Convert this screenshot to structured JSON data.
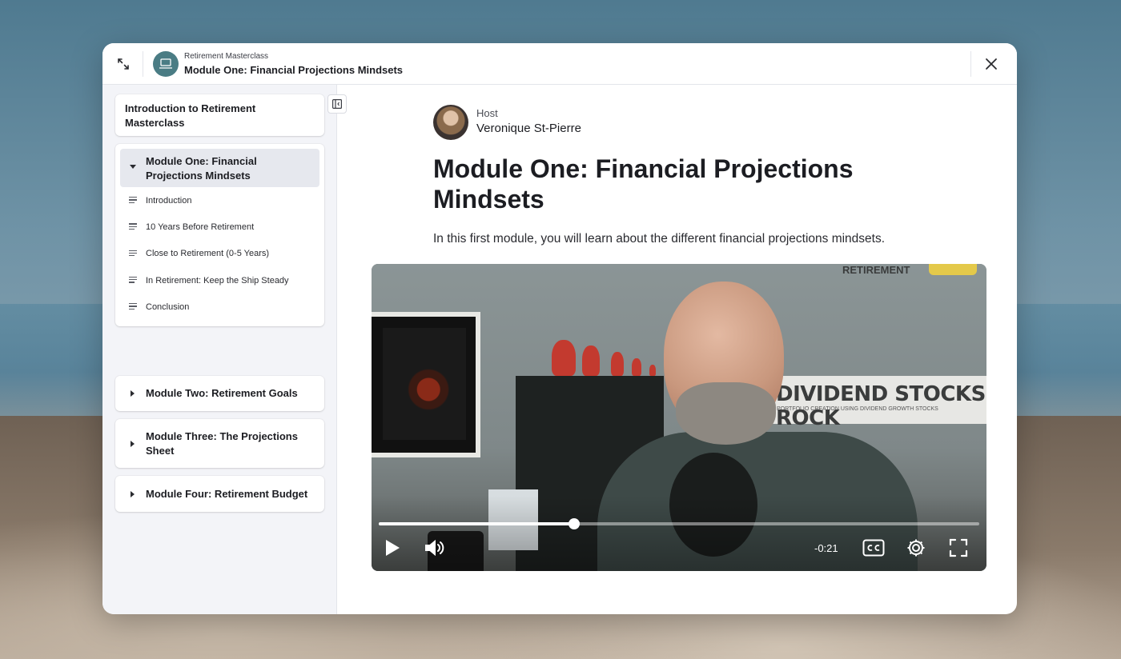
{
  "header": {
    "course_name": "Retirement Masterclass",
    "module_title": "Module One: Financial Projections Mindsets",
    "icons": {
      "expand": "expand-icon",
      "logo": "laptop-icon",
      "close": "close-icon"
    }
  },
  "sidebar": {
    "intro": "Introduction to Retirement Masterclass",
    "expanded_module": {
      "title": "Module One: Financial Projections Mindsets",
      "lessons": [
        "Introduction",
        "10 Years Before Retirement",
        "Close to Retirement (0-5 Years)",
        "In Retirement: Keep the Ship Steady",
        "Conclusion"
      ]
    },
    "collapsed_modules": [
      "Module Two: Retirement Goals",
      "Module Three: The Projections Sheet",
      "Module Four: Retirement Budget"
    ]
  },
  "main": {
    "host_label": "Host",
    "host_name": "Veronique St-Pierre",
    "title": "Module One: Financial Projections Mindsets",
    "description": "In this first module, you will learn about the different financial projections mindsets."
  },
  "video": {
    "brand_text": "RETIREMENT",
    "sign_text": "DIVIDEND STOCKS ROCK",
    "sign_subtext": "PORTFOLIO CREATION USING DIVIDEND GROWTH STOCKS",
    "time_remaining": "-0:21",
    "progress_fraction": 0.325,
    "icons": {
      "play": "play-icon",
      "volume": "volume-icon",
      "captions": "cc-icon",
      "settings": "gear-icon",
      "fullscreen": "fullscreen-icon"
    }
  }
}
